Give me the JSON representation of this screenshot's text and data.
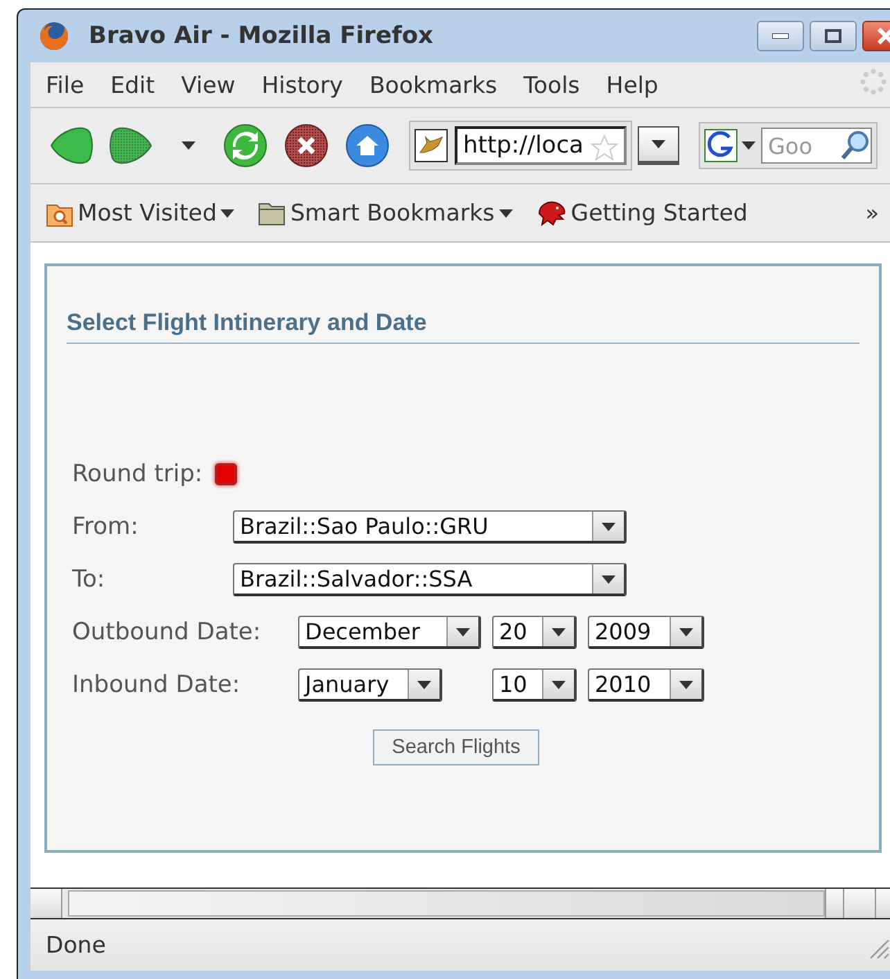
{
  "window": {
    "title": "Bravo Air - Mozilla Firefox"
  },
  "menu": [
    {
      "label": "File"
    },
    {
      "label": "Edit"
    },
    {
      "label": "View"
    },
    {
      "label": "History"
    },
    {
      "label": "Bookmarks"
    },
    {
      "label": "Tools"
    },
    {
      "label": "Help"
    }
  ],
  "nav_buttons": [
    {
      "kind": "back",
      "disabled": false
    },
    {
      "kind": "forward",
      "disabled": true
    },
    {
      "kind": "history"
    },
    {
      "kind": "reload",
      "disabled": false
    },
    {
      "kind": "stop",
      "disabled": true
    },
    {
      "kind": "home",
      "disabled": false
    }
  ],
  "address_bar": {
    "value": "http://loca"
  },
  "search_bar": {
    "placeholder": "Goo"
  },
  "bookmarks": [
    {
      "label": "Most Visited",
      "kind": "smart-folder",
      "has_menu": true
    },
    {
      "label": "Smart Bookmarks",
      "kind": "folder",
      "has_menu": true
    },
    {
      "label": "Getting Started",
      "kind": "page",
      "has_menu": false
    }
  ],
  "bookmarks_overflow": "»",
  "form": {
    "heading": "Select Flight Intinerary and Date",
    "round_trip": {
      "label": "Round trip:",
      "checked": true
    },
    "fields": [
      {
        "kind": "select",
        "label": "From:",
        "value": "Brazil::Sao Paulo::GRU"
      },
      {
        "kind": "select",
        "label": "To:",
        "value": "Brazil::Salvador::SSA"
      },
      {
        "kind": "date",
        "label": "Outbound Date:",
        "month": "December",
        "day": "20",
        "year": "2009"
      },
      {
        "kind": "date",
        "label": "Inbound Date:",
        "month": "January",
        "day": "10",
        "year": "2010"
      }
    ],
    "button": "Search Flights"
  },
  "status_bar": {
    "text": "Done"
  }
}
